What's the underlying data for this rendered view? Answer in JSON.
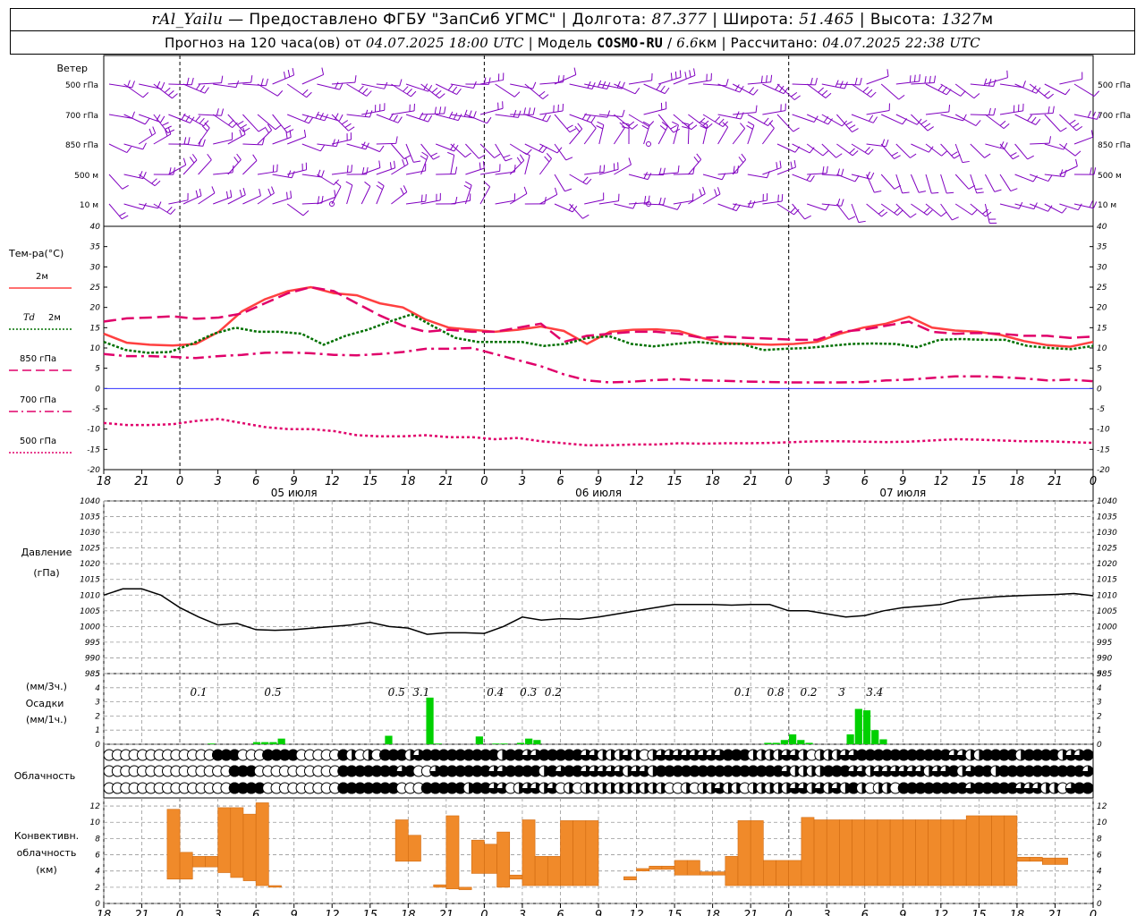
{
  "header": {
    "line1": [
      {
        "t": "rAl_Yailu",
        "it": true
      },
      {
        "t": " — Предоставлено ФГБУ \"ЗапСиб УГМС\" | Долгота: "
      },
      {
        "t": "87.377",
        "it": true
      },
      {
        "t": " | Широта: "
      },
      {
        "t": "51.465",
        "it": true
      },
      {
        "t": " | Высота: "
      },
      {
        "t": "1327",
        "it": true
      },
      {
        "t": "м"
      }
    ],
    "line2": [
      {
        "t": "Прогноз на 120 часа(ов) от "
      },
      {
        "t": "04.07.2025 18:00 UTC",
        "it": true
      },
      {
        "t": "  | Модель "
      },
      {
        "t": "COSMO-RU",
        "bd": true
      },
      {
        "t": " / "
      },
      {
        "t": "6.6",
        "it": true
      },
      {
        "t": "км | Рассчитано: "
      },
      {
        "t": "04.07.2025 22:38 UTC",
        "it": true
      }
    ]
  },
  "time_axis": {
    "hour_labels": [
      "18",
      "21",
      "0",
      "3",
      "6",
      "9",
      "12",
      "15",
      "18",
      "21",
      "0",
      "3",
      "6",
      "9",
      "12",
      "15",
      "18",
      "21",
      "0",
      "3",
      "6",
      "9",
      "12",
      "15",
      "18",
      "21",
      "0"
    ],
    "date_labels": [
      {
        "text": "05 июля",
        "index": 5
      },
      {
        "text": "06 июля",
        "index": 13
      },
      {
        "text": "07 июля",
        "index": 21
      }
    ],
    "midnight_indices": [
      2,
      10,
      18,
      26
    ]
  },
  "wind": {
    "title": "Ветер",
    "levels": [
      "500 гПа",
      "700 гПа",
      "850 гПа",
      "500 м",
      "10 м"
    ],
    "color": "#8000c0"
  },
  "chart_data": [
    {
      "type": "line",
      "name": "temperature",
      "ylabel": "Тем-ра(°С)",
      "ylim": [
        -20,
        40
      ],
      "yticks": [
        -20,
        -15,
        -10,
        -5,
        0,
        5,
        10,
        15,
        20,
        25,
        30,
        35,
        40
      ],
      "grid": false,
      "legend": [
        {
          "label": "2м",
          "color": "#ff4040",
          "style": "solid"
        },
        {
          "label": "Td 2м",
          "color": "#007000",
          "style": "dot"
        },
        {
          "label": "850 гПа",
          "color": "#e0006a",
          "style": "dash"
        },
        {
          "label": "700 гПа",
          "color": "#e0006a",
          "style": "dashdot"
        },
        {
          "label": "500 гПа",
          "color": "#e0006a",
          "style": "dot"
        }
      ],
      "x_hours": [
        0,
        3,
        6,
        9,
        12,
        15,
        18,
        21,
        24,
        27,
        30,
        33,
        36,
        39,
        42,
        45,
        48,
        51,
        54,
        57,
        60,
        63,
        66,
        69,
        72,
        75,
        78,
        81,
        84,
        87,
        90,
        93,
        96,
        99,
        102,
        105,
        108,
        111,
        114,
        117,
        120
      ],
      "series": [
        {
          "name": "2м",
          "values": [
            13.5,
            11.3,
            10.8,
            10.6,
            11,
            14,
            19,
            22,
            24,
            25,
            23.5,
            23,
            21,
            20,
            17,
            15,
            14.5,
            14,
            14.5,
            15.3,
            14.2,
            11,
            14,
            14.5,
            14.6,
            14.2,
            12.5,
            11.2,
            11,
            10.8,
            11,
            11.5,
            13.5,
            15,
            16,
            17.7,
            15,
            14.3,
            14,
            13.2,
            11.7,
            10.7,
            10.3,
            11.5
          ]
        },
        {
          "name": "Td 2м",
          "values": [
            11.5,
            9.5,
            8.8,
            9,
            11,
            13.5,
            15,
            14,
            14,
            13.5,
            10.8,
            13,
            14.5,
            16.5,
            18.3,
            15.3,
            12.5,
            11.5,
            11.5,
            11.5,
            10.5,
            11,
            12.5,
            12.9,
            11,
            10.4,
            11,
            11.5,
            11,
            11,
            9.5,
            9.8,
            10,
            10.5,
            11,
            11.1,
            11,
            10.2,
            12,
            12.2,
            12,
            12,
            10.5,
            10,
            9.7,
            10.5
          ]
        },
        {
          "name": "850 гПа",
          "values": [
            16.5,
            17.3,
            17.5,
            17.8,
            17.2,
            17.5,
            18.5,
            21,
            23.5,
            25,
            24,
            21,
            18,
            15.5,
            14,
            14.5,
            14,
            14,
            15,
            16,
            11.5,
            13,
            13.5,
            14,
            14,
            13.5,
            12.5,
            12.8,
            12.5,
            12.3,
            12,
            12,
            14,
            14.5,
            15.5,
            16.5,
            14,
            13.5,
            13.7,
            13.5,
            13,
            13,
            12.5,
            12.8
          ]
        },
        {
          "name": "700 гПа",
          "values": [
            8.5,
            8,
            8,
            7.8,
            7.5,
            8,
            8.3,
            8.8,
            8.9,
            8.7,
            8.3,
            8.2,
            8.5,
            9,
            9.8,
            9.8,
            10,
            8.5,
            7,
            5.5,
            3.5,
            2,
            1.5,
            1.7,
            2.1,
            2.3,
            2,
            1.9,
            1.7,
            1.6,
            1.5,
            1.5,
            1.5,
            1.6,
            2,
            2.2,
            2.6,
            3,
            3,
            2.8,
            2.5,
            2,
            2.2,
            1.8
          ]
        },
        {
          "name": "500 гПа",
          "values": [
            -8.5,
            -9,
            -9,
            -8.8,
            -8,
            -7.5,
            -8.5,
            -9.5,
            -10,
            -10,
            -10.5,
            -11.5,
            -11.8,
            -11.8,
            -11.5,
            -12,
            -12,
            -12.5,
            -12.2,
            -13,
            -13.5,
            -14,
            -14,
            -13.8,
            -13.8,
            -13.5,
            -13.6,
            -13.5,
            -13.5,
            -13.4,
            -13.2,
            -13,
            -13,
            -13.1,
            -13.2,
            -13.1,
            -12.8,
            -12.5,
            -12.6,
            -12.8,
            -13,
            -13,
            -13.2,
            -13.4
          ]
        }
      ]
    },
    {
      "type": "line",
      "name": "pressure",
      "ylabel": [
        "Давление",
        "(гПа)"
      ],
      "ylim": [
        985,
        1040
      ],
      "yticks": [
        985,
        990,
        995,
        1000,
        1005,
        1010,
        1015,
        1020,
        1025,
        1030,
        1035,
        1040
      ],
      "grid": true,
      "series": [
        {
          "name": "Давление",
          "color": "#000000",
          "values": [
            1010,
            1012,
            1012,
            1010,
            1006,
            1003,
            1000.5,
            1001,
            999,
            998.8,
            999,
            999.5,
            1000,
            1000.5,
            1001.3,
            1000,
            999.5,
            997.5,
            998,
            998,
            997.8,
            1000,
            1003,
            1002,
            1002.5,
            1002.3,
            1003,
            1004,
            1005,
            1006,
            1007,
            1007,
            1007,
            1006.8,
            1007,
            1007,
            1005,
            1005,
            1004,
            1003,
            1003.5,
            1005,
            1006,
            1006.5,
            1007,
            1008.5,
            1009,
            1009.5,
            1009.8,
            1010,
            1010.2,
            1010.5,
            1009.8
          ]
        }
      ]
    },
    {
      "type": "bar",
      "name": "precipitation",
      "ylabel": [
        "(мм/3ч.)",
        "Осадки",
        "(мм/1ч.)"
      ],
      "ylim": [
        0,
        5
      ],
      "yticks": [
        0,
        1,
        2,
        3,
        4,
        5
      ],
      "grid": true,
      "color": "#00d000",
      "bars": [
        {
          "h": 13.5,
          "v": 0.05
        },
        {
          "h": 19,
          "v": 0.15
        },
        {
          "h": 20,
          "v": 0.15
        },
        {
          "h": 21,
          "v": 0.15
        },
        {
          "h": 22,
          "v": 0.4
        },
        {
          "h": 35,
          "v": 0.6
        },
        {
          "h": 40,
          "v": 3.3
        },
        {
          "h": 41,
          "v": 0.05
        },
        {
          "h": 46,
          "v": 0.55
        },
        {
          "h": 48,
          "v": 0.05
        },
        {
          "h": 49,
          "v": 0.05
        },
        {
          "h": 51,
          "v": 0.1
        },
        {
          "h": 52,
          "v": 0.4
        },
        {
          "h": 53,
          "v": 0.3
        },
        {
          "h": 81,
          "v": 0.1
        },
        {
          "h": 82,
          "v": 0.1
        },
        {
          "h": 83,
          "v": 0.3
        },
        {
          "h": 84,
          "v": 0.7
        },
        {
          "h": 85,
          "v": 0.3
        },
        {
          "h": 86,
          "v": 0.1
        },
        {
          "h": 91,
          "v": 0.7
        },
        {
          "h": 92,
          "v": 2.5
        },
        {
          "h": 93,
          "v": 2.4
        },
        {
          "h": 94,
          "v": 1
        },
        {
          "h": 95,
          "v": 0.35
        }
      ],
      "annotations": [
        {
          "text": "0.1",
          "h": 12
        },
        {
          "text": "0.5",
          "h": 21
        },
        {
          "text": "0.5",
          "h": 36
        },
        {
          "text": "3.1",
          "h": 39
        },
        {
          "text": "0.4",
          "h": 48
        },
        {
          "text": "0.3",
          "h": 52
        },
        {
          "text": "0.2",
          "h": 55
        },
        {
          "text": "0.1",
          "h": 78
        },
        {
          "text": "0.8",
          "h": 82
        },
        {
          "text": "0.2",
          "h": 86
        },
        {
          "text": "3",
          "h": 90
        },
        {
          "text": "3.4",
          "h": 94
        }
      ]
    },
    {
      "type": "cloud_symbols",
      "name": "cloudiness",
      "ylabel": "Облачность",
      "rows": [
        "0000000000000333000333300000310103331233333333313322333332211121012222222233311112210111223333333333322113333133331223",
        "0000000000000003330000000000333333323002333333223333132332222212213333333333333332111133322122222212231233133333333332",
        "0000000000000003333000000000333333300033333133220122120101111111111001011211011111221212131011033333333233333222110233"
      ]
    },
    {
      "type": "bar",
      "name": "convective_cloud",
      "ylabel": [
        "Конвективн.",
        "облачность",
        "(км)"
      ],
      "ylim": [
        0,
        13
      ],
      "yticks": [
        0,
        2,
        4,
        6,
        8,
        10,
        12
      ],
      "grid": true,
      "color": "#f08a2a",
      "ranges": [
        {
          "h": 5,
          "b": 3,
          "t": 11.6
        },
        {
          "h": 6,
          "b": 3,
          "t": 6.3
        },
        {
          "h": 7,
          "b": 4.5,
          "t": 5.8
        },
        {
          "h": 8,
          "b": 4.5,
          "t": 5.8
        },
        {
          "h": 9,
          "b": 3.8,
          "t": 11.8
        },
        {
          "h": 10,
          "b": 3.2,
          "t": 11.8
        },
        {
          "h": 11,
          "b": 2.8,
          "t": 11
        },
        {
          "h": 12,
          "b": 2.2,
          "t": 12.4
        },
        {
          "h": 13,
          "b": 2.0,
          "t": 2.2
        },
        {
          "h": 23,
          "b": 5.2,
          "t": 10.3
        },
        {
          "h": 24,
          "b": 5.2,
          "t": 8.4
        },
        {
          "h": 26,
          "b": 2.0,
          "t": 2.3
        },
        {
          "h": 27,
          "b": 1.8,
          "t": 10.8
        },
        {
          "h": 28,
          "b": 1.7,
          "t": 2.0
        },
        {
          "h": 29,
          "b": 3.7,
          "t": 7.8
        },
        {
          "h": 30,
          "b": 3.7,
          "t": 7.3
        },
        {
          "h": 31,
          "b": 2.0,
          "t": 8.8
        },
        {
          "h": 32,
          "b": 3.0,
          "t": 3.5
        },
        {
          "h": 33,
          "b": 2.2,
          "t": 10.3
        },
        {
          "h": 34,
          "b": 2.2,
          "t": 5.8
        },
        {
          "h": 35,
          "b": 2.2,
          "t": 5.8
        },
        {
          "h": 36,
          "b": 2.2,
          "t": 10.2
        },
        {
          "h": 37,
          "b": 2.2,
          "t": 10.2
        },
        {
          "h": 38,
          "b": 2.2,
          "t": 10.2
        },
        {
          "h": 41,
          "b": 2.9,
          "t": 3.3
        },
        {
          "h": 42,
          "b": 4.0,
          "t": 4.3
        },
        {
          "h": 43,
          "b": 4.2,
          "t": 4.6
        },
        {
          "h": 44,
          "b": 4.2,
          "t": 4.6
        },
        {
          "h": 45,
          "b": 3.5,
          "t": 5.3
        },
        {
          "h": 46,
          "b": 3.5,
          "t": 5.3
        },
        {
          "h": 47,
          "b": 3.5,
          "t": 3.9
        },
        {
          "h": 48,
          "b": 3.5,
          "t": 3.9
        },
        {
          "h": 49,
          "b": 2.2,
          "t": 5.8
        },
        {
          "h": 50,
          "b": 2.2,
          "t": 10.2
        },
        {
          "h": 51,
          "b": 2.2,
          "t": 10.2
        },
        {
          "h": 52,
          "b": 2.2,
          "t": 5.3
        },
        {
          "h": 53,
          "b": 2.2,
          "t": 5.3
        },
        {
          "h": 54,
          "b": 2.2,
          "t": 5.3
        },
        {
          "h": 55,
          "b": 2.2,
          "t": 10.6
        },
        {
          "h": 56,
          "b": 2.2,
          "t": 10.3
        },
        {
          "h": 57,
          "b": 2.2,
          "t": 10.3
        },
        {
          "h": 58,
          "b": 2.2,
          "t": 10.3
        },
        {
          "h": 59,
          "b": 2.2,
          "t": 10.3
        },
        {
          "h": 60,
          "b": 2.2,
          "t": 10.3
        },
        {
          "h": 61,
          "b": 2.2,
          "t": 10.3
        },
        {
          "h": 62,
          "b": 2.2,
          "t": 10.3
        },
        {
          "h": 63,
          "b": 2.2,
          "t": 10.3
        },
        {
          "h": 64,
          "b": 2.2,
          "t": 10.3
        },
        {
          "h": 65,
          "b": 2.2,
          "t": 10.3
        },
        {
          "h": 66,
          "b": 2.2,
          "t": 10.3
        },
        {
          "h": 67,
          "b": 2.2,
          "t": 10.3
        },
        {
          "h": 68,
          "b": 2.2,
          "t": 10.8
        },
        {
          "h": 69,
          "b": 2.2,
          "t": 10.8
        },
        {
          "h": 70,
          "b": 2.2,
          "t": 10.8
        },
        {
          "h": 71,
          "b": 2.2,
          "t": 10.8
        },
        {
          "h": 72,
          "b": 5.2,
          "t": 5.7
        },
        {
          "h": 73,
          "b": 5.2,
          "t": 5.7
        },
        {
          "h": 74,
          "b": 4.8,
          "t": 5.6
        },
        {
          "h": 75,
          "b": 4.8,
          "t": 5.6
        }
      ]
    }
  ]
}
